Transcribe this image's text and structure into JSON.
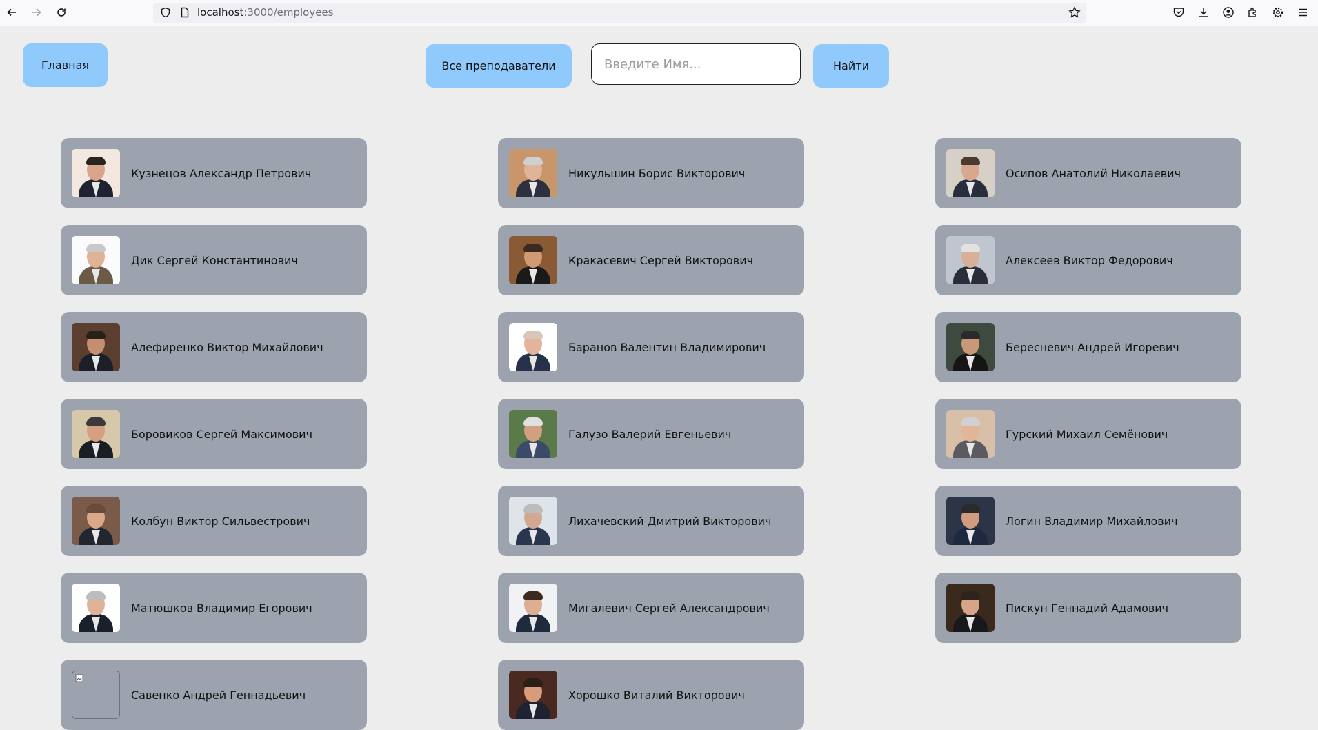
{
  "browser": {
    "url_host": "localhost",
    "url_path": ":3000/employees"
  },
  "toolbar": {
    "home_label": "Главная",
    "all_teachers_label": "Все преподаватели",
    "search_placeholder": "Введите Имя...",
    "search_value": "",
    "find_label": "Найти"
  },
  "employees": [
    {
      "name": "Кузнецов Александр Петрович"
    },
    {
      "name": "Никульшин Борис Викторович"
    },
    {
      "name": "Осипов Анатолий Николаевич"
    },
    {
      "name": "Дик Сергей Константинович"
    },
    {
      "name": "Кракасевич Сергей Викторович"
    },
    {
      "name": "Алексеев Виктор Федорович"
    },
    {
      "name": "Алефиренко Виктор Михайлович"
    },
    {
      "name": "Баранов Валентин Владимирович"
    },
    {
      "name": "Береcневич Андрей Игоревич"
    },
    {
      "name": "Боровиков Сергей Максимович"
    },
    {
      "name": "Галузо Валерий Евгеньевич"
    },
    {
      "name": "Гурский Михаил Семёнович"
    },
    {
      "name": "Колбун Виктор Сильвестрович"
    },
    {
      "name": "Лихачевский Дмитрий Викторович"
    },
    {
      "name": "Логин Владимир Михайлович"
    },
    {
      "name": "Матюшков Владимир Егорович"
    },
    {
      "name": "Мигалевич Сергей Александрович"
    },
    {
      "name": "Пискун Геннадий Адамович"
    },
    {
      "name": "Савенко Андрей Геннадьевич"
    },
    {
      "name": "Хорошко Виталий Викторович"
    }
  ]
}
